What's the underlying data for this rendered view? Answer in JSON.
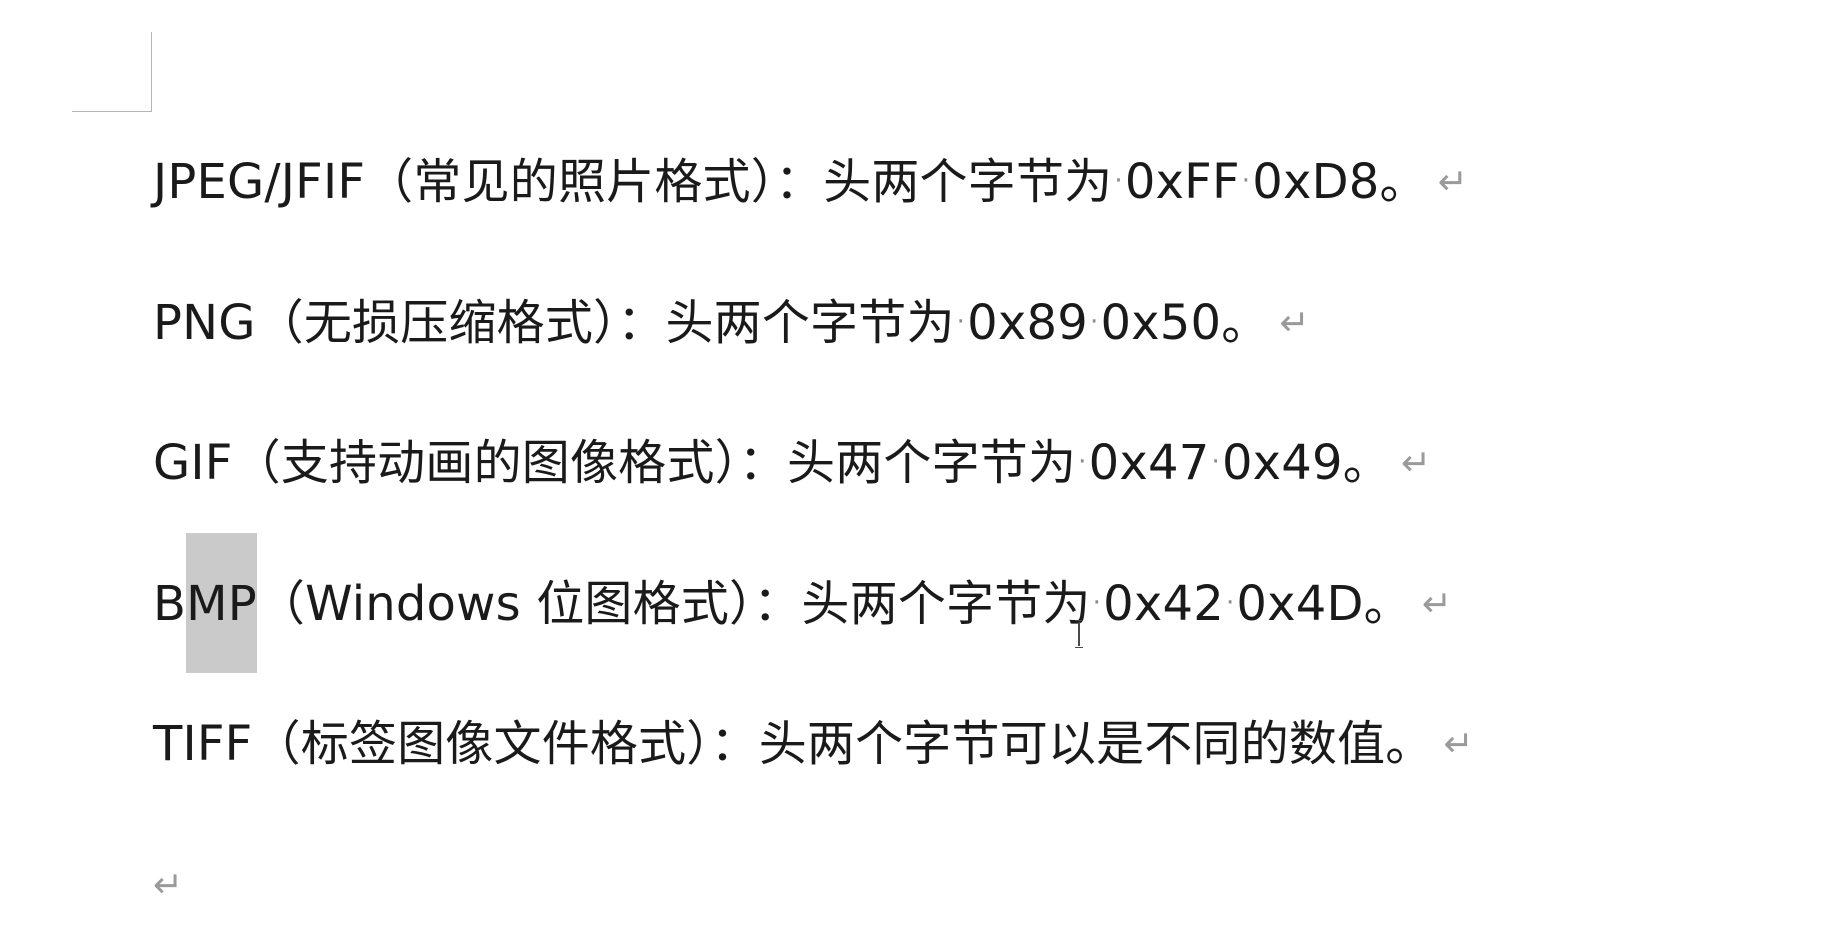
{
  "document": {
    "paragraphs": [
      {
        "format": "JPEG/JFIF",
        "desc": "（常见的照片格式）：头两个字节为",
        "bytes": [
          "0xFF",
          "0xD8"
        ],
        "end": "。"
      },
      {
        "format": "PNG",
        "desc": "（无损压缩格式）：头两个字节为",
        "bytes": [
          "0x89",
          "0x50"
        ],
        "end": "。"
      },
      {
        "format": "GIF",
        "desc": "（支持动画的图像格式）：头两个字节为",
        "bytes": [
          "0x47",
          "0x49"
        ],
        "end": "。"
      },
      {
        "format_pre": "B",
        "format_sel": "MP",
        "desc": "（Windows 位图格式）：头两个字节为",
        "bytes": [
          "0x42",
          "0x4D"
        ],
        "end": "。"
      },
      {
        "text": "TIFF（标签图像文件格式）：头两个字节可以是不同的数值。"
      }
    ],
    "paragraph_mark": "↵",
    "space_mark": "·"
  }
}
